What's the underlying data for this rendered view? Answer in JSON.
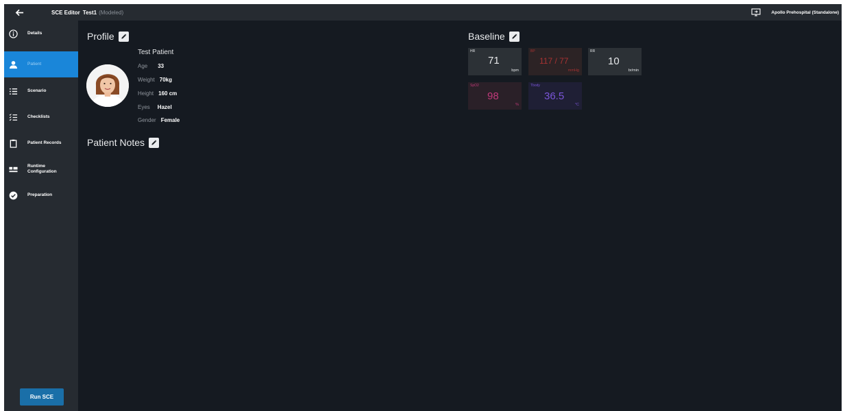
{
  "topbar": {
    "back_icon": "arrow-left-icon",
    "app_title": "SCE Editor",
    "sce_name": "Test1",
    "sce_mode": "(Modeled)",
    "simulator_icon": "monitor-icon",
    "simulator_label": "Apollo Prehospital (Standalone)"
  },
  "sidebar": {
    "items": [
      {
        "label": "Details",
        "icon": "info-icon"
      },
      {
        "label": "Patient",
        "icon": "person-icon"
      },
      {
        "label": "Scenario",
        "icon": "list-icon"
      },
      {
        "label": "Checklists",
        "icon": "checklist-icon"
      },
      {
        "label": "Patient Records",
        "icon": "clipboard-icon"
      },
      {
        "label": "Runtime Configuration",
        "icon": "layout-icon"
      },
      {
        "label": "Preparation",
        "icon": "check-circle-icon"
      }
    ],
    "active_item": "Patient",
    "run_button": "Run SCE"
  },
  "profile": {
    "title": "Profile",
    "name": "Test Patient",
    "fields": [
      {
        "key": "Age",
        "value": "33"
      },
      {
        "key": "Weight",
        "value": "70kg"
      },
      {
        "key": "Height",
        "value": "160 cm"
      },
      {
        "key": "Eyes",
        "value": "Hazel"
      },
      {
        "key": "Gender",
        "value": "Female"
      }
    ]
  },
  "notes": {
    "title": "Patient Notes"
  },
  "baseline": {
    "title": "Baseline",
    "vitals": [
      {
        "label": "HR",
        "value": "71",
        "unit": "bpm",
        "color": "#e6e8ea",
        "bg": "#2c3136"
      },
      {
        "label": "BP",
        "value": "117 / 77",
        "unit": "mmHg",
        "color": "#a83232",
        "bg": "#2c2325"
      },
      {
        "label": "RR",
        "value": "10",
        "unit": "br/min",
        "color": "#e6e8ea",
        "bg": "#2c3136"
      },
      {
        "label": "SpO2",
        "value": "98",
        "unit": "%",
        "color": "#c0397a",
        "bg": "#2a2028"
      },
      {
        "label": "Tbody",
        "value": "36.5",
        "unit": "°C",
        "color": "#7a55d8",
        "bg": "#1f1f35"
      }
    ]
  },
  "colors": {
    "accent": "#1a86d9",
    "background": "#151a21",
    "sidebar": "#262b31",
    "run_button": "#1a6fa8"
  }
}
